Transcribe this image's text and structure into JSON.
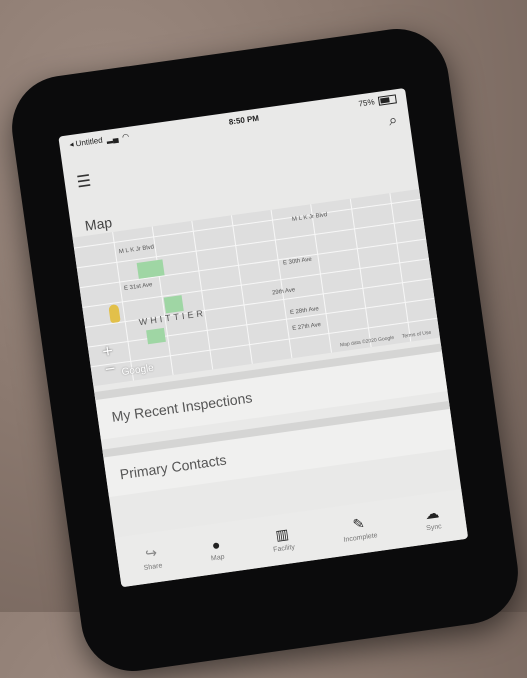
{
  "status_bar": {
    "carrier": "◂ Untitled",
    "time": "8:50 PM",
    "battery": "75%"
  },
  "header": {
    "map_title": "Map"
  },
  "map": {
    "streets": [
      "M L K Jr Blvd",
      "E 31st Ave",
      "29th Ave",
      "E 28th Ave",
      "E 27th Ave",
      "E 30th Ave",
      "M L K Jr Blvd"
    ],
    "neighborhood": "WHITTIER",
    "attribution": "Map data ©2020 Google",
    "terms": "Terms of Use",
    "zoom_in": "+",
    "zoom_out": "−",
    "logo": "Google"
  },
  "sections": [
    {
      "label": "My Recent Inspections"
    },
    {
      "label": "Primary Contacts"
    }
  ],
  "tabbar": {
    "items": [
      {
        "label": "Share",
        "icon": "share-icon"
      },
      {
        "label": "Map",
        "icon": "map-pin-icon"
      },
      {
        "label": "Facility",
        "icon": "building-icon"
      },
      {
        "label": "Incomplete",
        "icon": "edit-icon"
      },
      {
        "label": "Sync",
        "icon": "cloud-icon"
      }
    ]
  }
}
